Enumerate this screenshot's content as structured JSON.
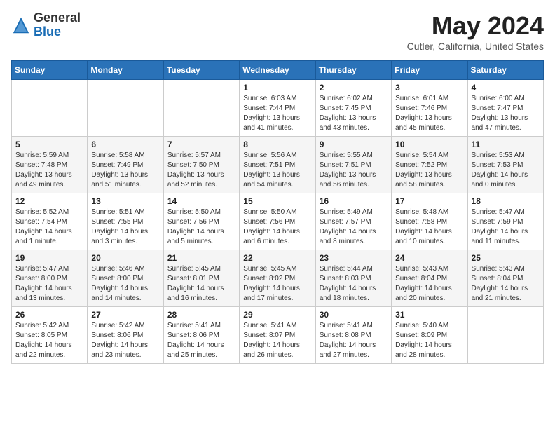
{
  "header": {
    "logo_general": "General",
    "logo_blue": "Blue",
    "month_title": "May 2024",
    "location": "Cutler, California, United States"
  },
  "days_of_week": [
    "Sunday",
    "Monday",
    "Tuesday",
    "Wednesday",
    "Thursday",
    "Friday",
    "Saturday"
  ],
  "weeks": [
    {
      "days": [
        {
          "num": "",
          "info": ""
        },
        {
          "num": "",
          "info": ""
        },
        {
          "num": "",
          "info": ""
        },
        {
          "num": "1",
          "info": "Sunrise: 6:03 AM\nSunset: 7:44 PM\nDaylight: 13 hours\nand 41 minutes."
        },
        {
          "num": "2",
          "info": "Sunrise: 6:02 AM\nSunset: 7:45 PM\nDaylight: 13 hours\nand 43 minutes."
        },
        {
          "num": "3",
          "info": "Sunrise: 6:01 AM\nSunset: 7:46 PM\nDaylight: 13 hours\nand 45 minutes."
        },
        {
          "num": "4",
          "info": "Sunrise: 6:00 AM\nSunset: 7:47 PM\nDaylight: 13 hours\nand 47 minutes."
        }
      ]
    },
    {
      "days": [
        {
          "num": "5",
          "info": "Sunrise: 5:59 AM\nSunset: 7:48 PM\nDaylight: 13 hours\nand 49 minutes."
        },
        {
          "num": "6",
          "info": "Sunrise: 5:58 AM\nSunset: 7:49 PM\nDaylight: 13 hours\nand 51 minutes."
        },
        {
          "num": "7",
          "info": "Sunrise: 5:57 AM\nSunset: 7:50 PM\nDaylight: 13 hours\nand 52 minutes."
        },
        {
          "num": "8",
          "info": "Sunrise: 5:56 AM\nSunset: 7:51 PM\nDaylight: 13 hours\nand 54 minutes."
        },
        {
          "num": "9",
          "info": "Sunrise: 5:55 AM\nSunset: 7:51 PM\nDaylight: 13 hours\nand 56 minutes."
        },
        {
          "num": "10",
          "info": "Sunrise: 5:54 AM\nSunset: 7:52 PM\nDaylight: 13 hours\nand 58 minutes."
        },
        {
          "num": "11",
          "info": "Sunrise: 5:53 AM\nSunset: 7:53 PM\nDaylight: 14 hours\nand 0 minutes."
        }
      ]
    },
    {
      "days": [
        {
          "num": "12",
          "info": "Sunrise: 5:52 AM\nSunset: 7:54 PM\nDaylight: 14 hours\nand 1 minute."
        },
        {
          "num": "13",
          "info": "Sunrise: 5:51 AM\nSunset: 7:55 PM\nDaylight: 14 hours\nand 3 minutes."
        },
        {
          "num": "14",
          "info": "Sunrise: 5:50 AM\nSunset: 7:56 PM\nDaylight: 14 hours\nand 5 minutes."
        },
        {
          "num": "15",
          "info": "Sunrise: 5:50 AM\nSunset: 7:56 PM\nDaylight: 14 hours\nand 6 minutes."
        },
        {
          "num": "16",
          "info": "Sunrise: 5:49 AM\nSunset: 7:57 PM\nDaylight: 14 hours\nand 8 minutes."
        },
        {
          "num": "17",
          "info": "Sunrise: 5:48 AM\nSunset: 7:58 PM\nDaylight: 14 hours\nand 10 minutes."
        },
        {
          "num": "18",
          "info": "Sunrise: 5:47 AM\nSunset: 7:59 PM\nDaylight: 14 hours\nand 11 minutes."
        }
      ]
    },
    {
      "days": [
        {
          "num": "19",
          "info": "Sunrise: 5:47 AM\nSunset: 8:00 PM\nDaylight: 14 hours\nand 13 minutes."
        },
        {
          "num": "20",
          "info": "Sunrise: 5:46 AM\nSunset: 8:00 PM\nDaylight: 14 hours\nand 14 minutes."
        },
        {
          "num": "21",
          "info": "Sunrise: 5:45 AM\nSunset: 8:01 PM\nDaylight: 14 hours\nand 16 minutes."
        },
        {
          "num": "22",
          "info": "Sunrise: 5:45 AM\nSunset: 8:02 PM\nDaylight: 14 hours\nand 17 minutes."
        },
        {
          "num": "23",
          "info": "Sunrise: 5:44 AM\nSunset: 8:03 PM\nDaylight: 14 hours\nand 18 minutes."
        },
        {
          "num": "24",
          "info": "Sunrise: 5:43 AM\nSunset: 8:04 PM\nDaylight: 14 hours\nand 20 minutes."
        },
        {
          "num": "25",
          "info": "Sunrise: 5:43 AM\nSunset: 8:04 PM\nDaylight: 14 hours\nand 21 minutes."
        }
      ]
    },
    {
      "days": [
        {
          "num": "26",
          "info": "Sunrise: 5:42 AM\nSunset: 8:05 PM\nDaylight: 14 hours\nand 22 minutes."
        },
        {
          "num": "27",
          "info": "Sunrise: 5:42 AM\nSunset: 8:06 PM\nDaylight: 14 hours\nand 23 minutes."
        },
        {
          "num": "28",
          "info": "Sunrise: 5:41 AM\nSunset: 8:06 PM\nDaylight: 14 hours\nand 25 minutes."
        },
        {
          "num": "29",
          "info": "Sunrise: 5:41 AM\nSunset: 8:07 PM\nDaylight: 14 hours\nand 26 minutes."
        },
        {
          "num": "30",
          "info": "Sunrise: 5:41 AM\nSunset: 8:08 PM\nDaylight: 14 hours\nand 27 minutes."
        },
        {
          "num": "31",
          "info": "Sunrise: 5:40 AM\nSunset: 8:09 PM\nDaylight: 14 hours\nand 28 minutes."
        },
        {
          "num": "",
          "info": ""
        }
      ]
    }
  ]
}
